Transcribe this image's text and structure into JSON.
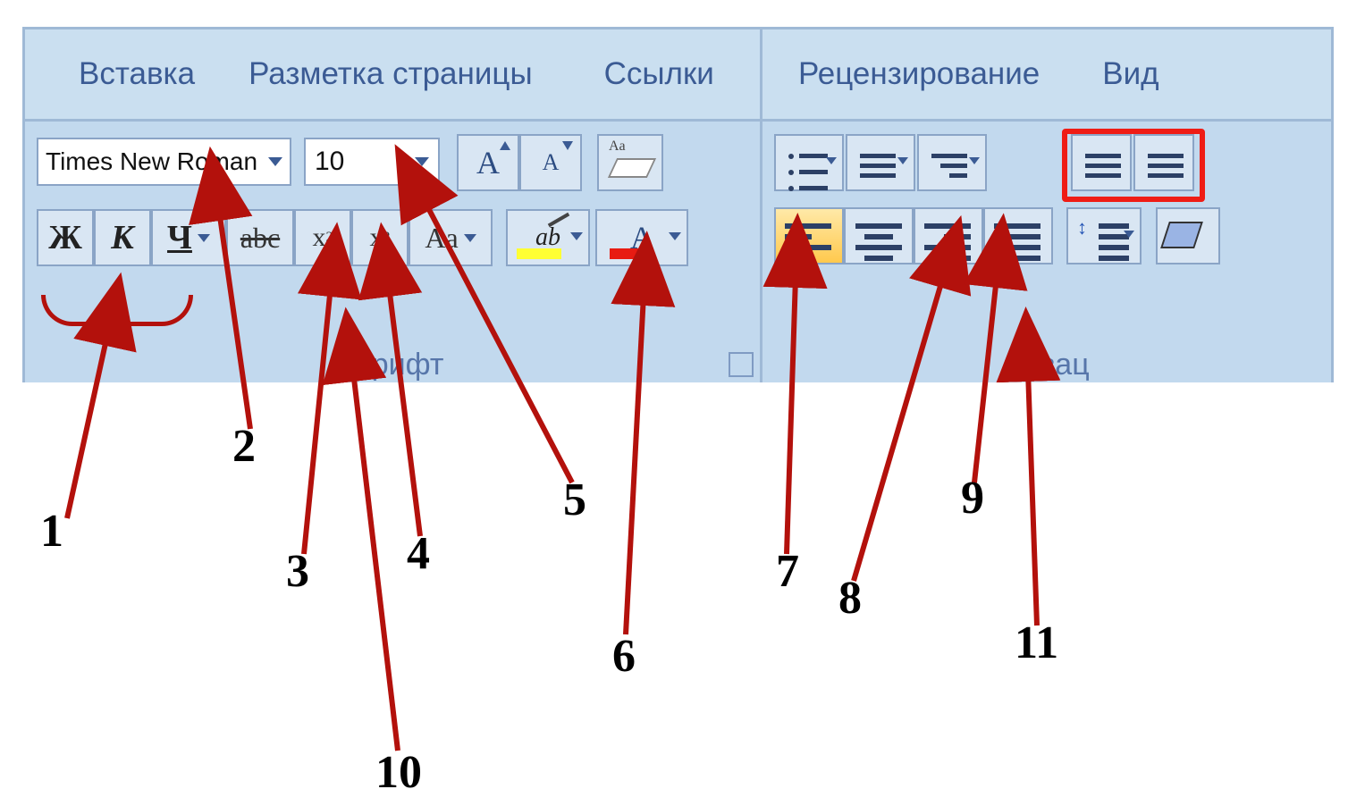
{
  "annotations": {
    "1": "1",
    "2": "2",
    "3": "3",
    "4": "4",
    "5": "5",
    "6": "6",
    "7": "7",
    "8": "8",
    "9": "9",
    "10": "10",
    "11": "11"
  },
  "ribbon_font": {
    "tabs": {
      "insert": "Вставка",
      "layout": "Разметка страницы",
      "refs": "Ссылки"
    },
    "font_name": "Times New Roman",
    "font_size": "10",
    "group": "Шрифт",
    "bold": "Ж",
    "italic": "К",
    "underline": "Ч",
    "strike": "abc",
    "case": "Aa",
    "subscript_x": "x",
    "subscript_2": "2",
    "superscript_x": "x",
    "superscript_2": "2",
    "highlight_text": "ab",
    "fontcolor_A": "A",
    "grow": "A",
    "shrink": "A"
  },
  "ribbon_para": {
    "tabs": {
      "review": "Рецензирование",
      "view": "Вид"
    },
    "group": "Абзац"
  }
}
